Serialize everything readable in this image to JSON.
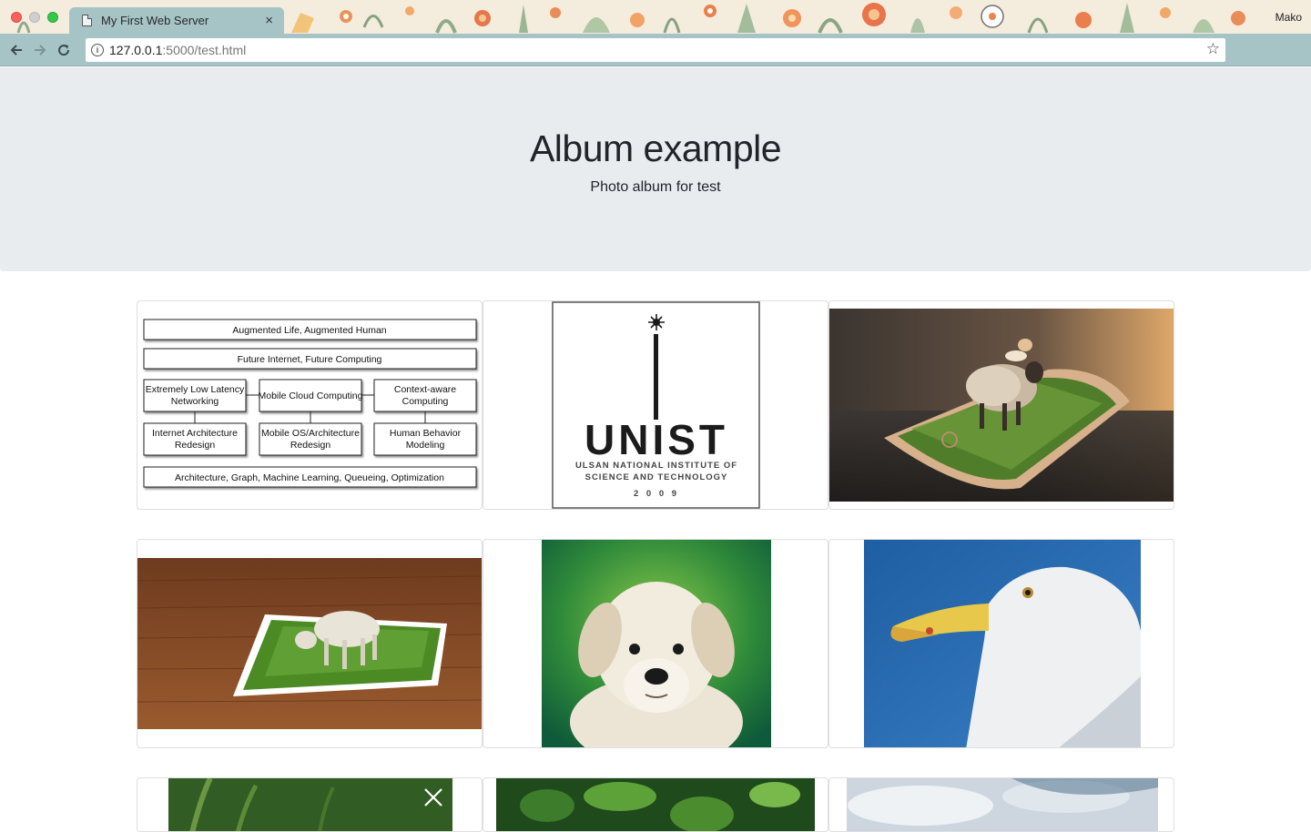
{
  "browser": {
    "tab_title": "My First Web Server",
    "tab_close": "×",
    "profile_name": "Mako",
    "url_host": "127.0.0.1",
    "url_rest": ":5000/test.html",
    "star_icon": "star-icon",
    "menu_icon": "⋮"
  },
  "jumbotron": {
    "title": "Album example",
    "subtitle": "Photo album for test"
  },
  "cards": {
    "diagram": {
      "boxes": [
        "Augmented Life, Augmented Human",
        "Future Internet, Future Computing",
        "Extremely Low Latency",
        "Networking",
        "Mobile Cloud Computing",
        "Context-aware",
        "Computing",
        "Internet Architecture",
        "Redesign",
        "Mobile OS/Architecture",
        "Redesign",
        "Human Behavior",
        "Modeling",
        "Architecture, Graph, Machine Learning, Queueing, Optimization"
      ]
    },
    "logo": {
      "wordmark": "UNIST",
      "line1": "ULSAN NATIONAL INSTITUTE OF",
      "line2": "SCIENCE AND TECHNOLOGY",
      "year": "2 0 0 9"
    },
    "photo_close_icon": "close-icon"
  }
}
